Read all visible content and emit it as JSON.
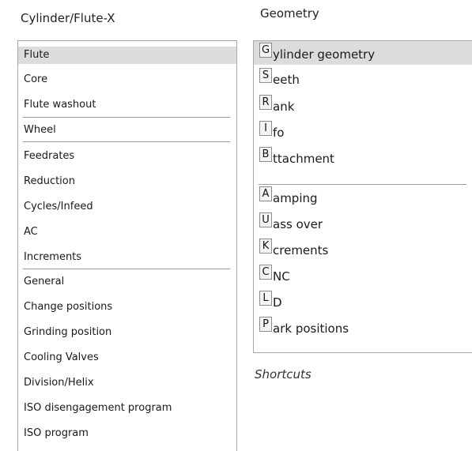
{
  "left_panel": {
    "title": "Cylinder/Flute-X",
    "items": [
      {
        "label": "Flute",
        "selected": true
      },
      {
        "label": "Core"
      },
      {
        "label": "Flute washout"
      },
      {
        "label": "Wheel"
      },
      {
        "label": "Feedrates"
      },
      {
        "label": "Reduction"
      },
      {
        "label": "Cycles/Infeed"
      },
      {
        "label": "AC"
      },
      {
        "label": "Increments"
      },
      {
        "label": "General"
      },
      {
        "label": "Change positions"
      },
      {
        "label": "Grinding position"
      },
      {
        "label": "Cooling Valves"
      },
      {
        "label": "Division/Helix"
      },
      {
        "label": "ISO disengagement program"
      },
      {
        "label": "ISO program"
      }
    ]
  },
  "right_panel": {
    "title": "Geometry",
    "items": [
      {
        "key": "G",
        "label": "ylinder geometry",
        "selected": true
      },
      {
        "key": "S",
        "label": "eeth"
      },
      {
        "key": "R",
        "label": "ank"
      },
      {
        "key": "I",
        "label": "fo"
      },
      {
        "key": "B",
        "label": "ttachment"
      },
      {
        "key": "A",
        "label": "amping"
      },
      {
        "key": "U",
        "label": "ass over"
      },
      {
        "key": "K",
        "label": "crements"
      },
      {
        "key": "C",
        "label": "NC"
      },
      {
        "key": "L",
        "label": "D"
      },
      {
        "key": "P",
        "label": "ark positions"
      }
    ],
    "footer_label": "Shortcuts"
  },
  "colors": {
    "selected_bg": "#dcdcdc",
    "border": "#a8a8a8"
  }
}
